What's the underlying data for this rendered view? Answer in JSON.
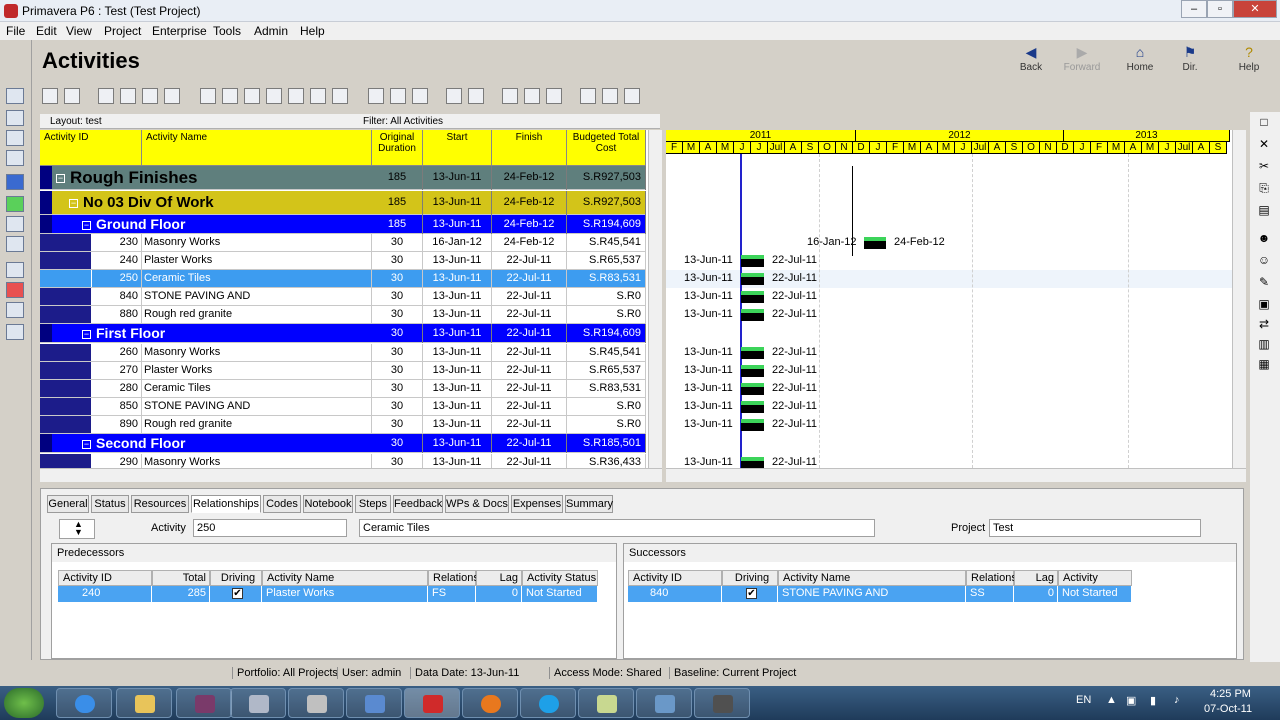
{
  "window": {
    "title": "Primavera P6 : Test (Test Project)",
    "buttons": [
      "–",
      "▫",
      "✕"
    ]
  },
  "menu": [
    "File",
    "Edit",
    "View",
    "Project",
    "Enterprise",
    "Tools",
    "Admin",
    "Help"
  ],
  "header": {
    "title": "Activities"
  },
  "nav": [
    {
      "label": "Back",
      "glyph": "◀"
    },
    {
      "label": "Forward",
      "glyph": "▶"
    },
    {
      "label": "Home",
      "glyph": "⌂"
    },
    {
      "label": "Dir.",
      "glyph": "⚑"
    },
    {
      "label": "Help",
      "glyph": "?"
    }
  ],
  "layoutbar": {
    "layout": "Layout: test",
    "filter": "Filter: All Activities"
  },
  "columns": [
    "Activity ID",
    "Activity Name",
    "Original Duration",
    "Start",
    "Finish",
    "Budgeted Total Cost"
  ],
  "rows": [
    {
      "type": "wbs1",
      "title": "Rough Finishes",
      "dur": "185",
      "start": "13-Jun-11",
      "finish": "24-Feb-12",
      "cost": "S.R927,503"
    },
    {
      "type": "wbs2",
      "title": "No 03 Div Of Work",
      "dur": "185",
      "start": "13-Jun-11",
      "finish": "24-Feb-12",
      "cost": "S.R927,503"
    },
    {
      "type": "wbs3",
      "title": "Ground Floor",
      "dur": "185",
      "start": "13-Jun-11",
      "finish": "24-Feb-12",
      "cost": "S.R194,609"
    },
    {
      "type": "act",
      "id": "230",
      "name": "Masonry Works",
      "dur": "30",
      "start": "16-Jan-12",
      "finish": "24-Feb-12",
      "cost": "S.R45,541"
    },
    {
      "type": "act",
      "id": "240",
      "name": "Plaster Works",
      "dur": "30",
      "start": "13-Jun-11",
      "finish": "22-Jul-11",
      "cost": "S.R65,537"
    },
    {
      "type": "sel",
      "id": "250",
      "name": "Ceramic Tiles",
      "dur": "30",
      "start": "13-Jun-11",
      "finish": "22-Jul-11",
      "cost": "S.R83,531"
    },
    {
      "type": "act",
      "id": "840",
      "name": "STONE PAVING AND",
      "dur": "30",
      "start": "13-Jun-11",
      "finish": "22-Jul-11",
      "cost": "S.R0"
    },
    {
      "type": "act",
      "id": "880",
      "name": "Rough red granite",
      "dur": "30",
      "start": "13-Jun-11",
      "finish": "22-Jul-11",
      "cost": "S.R0"
    },
    {
      "type": "wbs3",
      "title": "First Floor",
      "dur": "30",
      "start": "13-Jun-11",
      "finish": "22-Jul-11",
      "cost": "S.R194,609"
    },
    {
      "type": "act",
      "id": "260",
      "name": "Masonry Works",
      "dur": "30",
      "start": "13-Jun-11",
      "finish": "22-Jul-11",
      "cost": "S.R45,541"
    },
    {
      "type": "act",
      "id": "270",
      "name": "Plaster Works",
      "dur": "30",
      "start": "13-Jun-11",
      "finish": "22-Jul-11",
      "cost": "S.R65,537"
    },
    {
      "type": "act",
      "id": "280",
      "name": "Ceramic Tiles",
      "dur": "30",
      "start": "13-Jun-11",
      "finish": "22-Jul-11",
      "cost": "S.R83,531"
    },
    {
      "type": "act",
      "id": "850",
      "name": "STONE PAVING AND",
      "dur": "30",
      "start": "13-Jun-11",
      "finish": "22-Jul-11",
      "cost": "S.R0"
    },
    {
      "type": "act",
      "id": "890",
      "name": "Rough red granite",
      "dur": "30",
      "start": "13-Jun-11",
      "finish": "22-Jul-11",
      "cost": "S.R0"
    },
    {
      "type": "wbs3",
      "title": "Second Floor",
      "dur": "30",
      "start": "13-Jun-11",
      "finish": "22-Jul-11",
      "cost": "S.R185,501"
    },
    {
      "type": "act",
      "id": "290",
      "name": "Masonry Works",
      "dur": "30",
      "start": "13-Jun-11",
      "finish": "22-Jul-11",
      "cost": "S.R36,433"
    }
  ],
  "gantt": {
    "years": [
      "2011",
      "2012",
      "2013"
    ],
    "months": [
      "F",
      "M",
      "A",
      "M",
      "J",
      "J",
      "Jul",
      "A",
      "S",
      "O",
      "N",
      "D",
      "J",
      "F",
      "M",
      "A",
      "M",
      "J",
      "Jul",
      "A",
      "S",
      "O",
      "N",
      "D",
      "J",
      "F",
      "M",
      "A",
      "M",
      "J",
      "Jul",
      "A",
      "S"
    ]
  },
  "bottom": {
    "tabs": [
      "General",
      "Status",
      "Resources",
      "Relationships",
      "Codes",
      "Notebook",
      "Steps",
      "Feedback",
      "WPs & Docs",
      "Expenses",
      "Summary"
    ],
    "activity_label": "Activity",
    "activity_id": "250",
    "activity_name": "Ceramic Tiles",
    "project_label": "Project",
    "project": "Test",
    "predecessors": {
      "title": "Predecessors",
      "headers": [
        "Activity ID",
        "Total Float",
        "Driving",
        "Activity Name",
        "Relations",
        "Lag",
        "Activity Status"
      ],
      "row": {
        "id": "240",
        "float": "285",
        "driving": "✔",
        "name": "Plaster Works",
        "rel": "FS",
        "lag": "0",
        "status": "Not Started"
      }
    },
    "successors": {
      "title": "Successors",
      "headers": [
        "Activity ID",
        "Driving",
        "Activity Name",
        "Relations",
        "Lag",
        "Activity Status"
      ],
      "row": {
        "id": "840",
        "driving": "✔",
        "name": "STONE PAVING AND",
        "rel": "SS",
        "lag": "0",
        "status": "Not Started"
      }
    }
  },
  "status": {
    "portfolio": "Portfolio: All Projects",
    "user": "User: admin",
    "data_date": "Data Date: 13-Jun-11",
    "access": "Access Mode: Shared",
    "baseline": "Baseline: Current Project"
  },
  "tray": {
    "lang": "EN",
    "time": "4:25 PM",
    "date": "07-Oct-11"
  }
}
